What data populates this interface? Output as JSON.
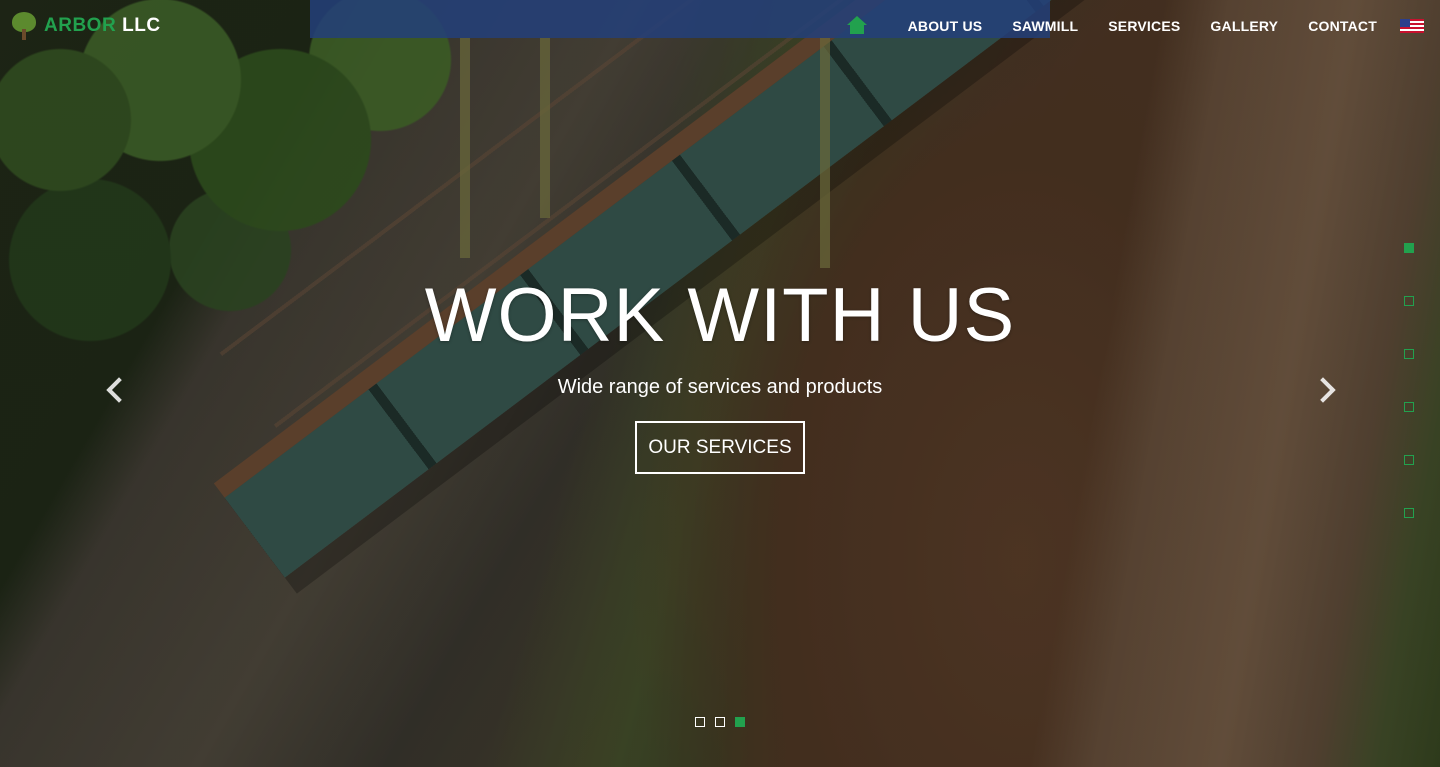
{
  "brand": {
    "word_a": "ARBOR",
    "word_b": "LLC",
    "logo_icon": "tree-icon"
  },
  "nav": {
    "home_icon": "home-icon",
    "items": [
      {
        "label": "ABOUT US"
      },
      {
        "label": "SAWMILL"
      },
      {
        "label": "SERVICES"
      },
      {
        "label": "GALLERY"
      },
      {
        "label": "CONTACT"
      }
    ],
    "language_icon": "us-flag-icon"
  },
  "hero": {
    "title": "WORK WITH US",
    "subtitle": "Wide range of services and products",
    "cta_label": "OUR SERVICES"
  },
  "carousel": {
    "prev_icon": "chevron-left-icon",
    "next_icon": "chevron-right-icon",
    "indicator_count": 3,
    "active_indicator": 3
  },
  "side_nav": {
    "dot_count": 6,
    "active_dot": 1
  },
  "colors": {
    "accent": "#22a14e",
    "text": "#ffffff"
  }
}
